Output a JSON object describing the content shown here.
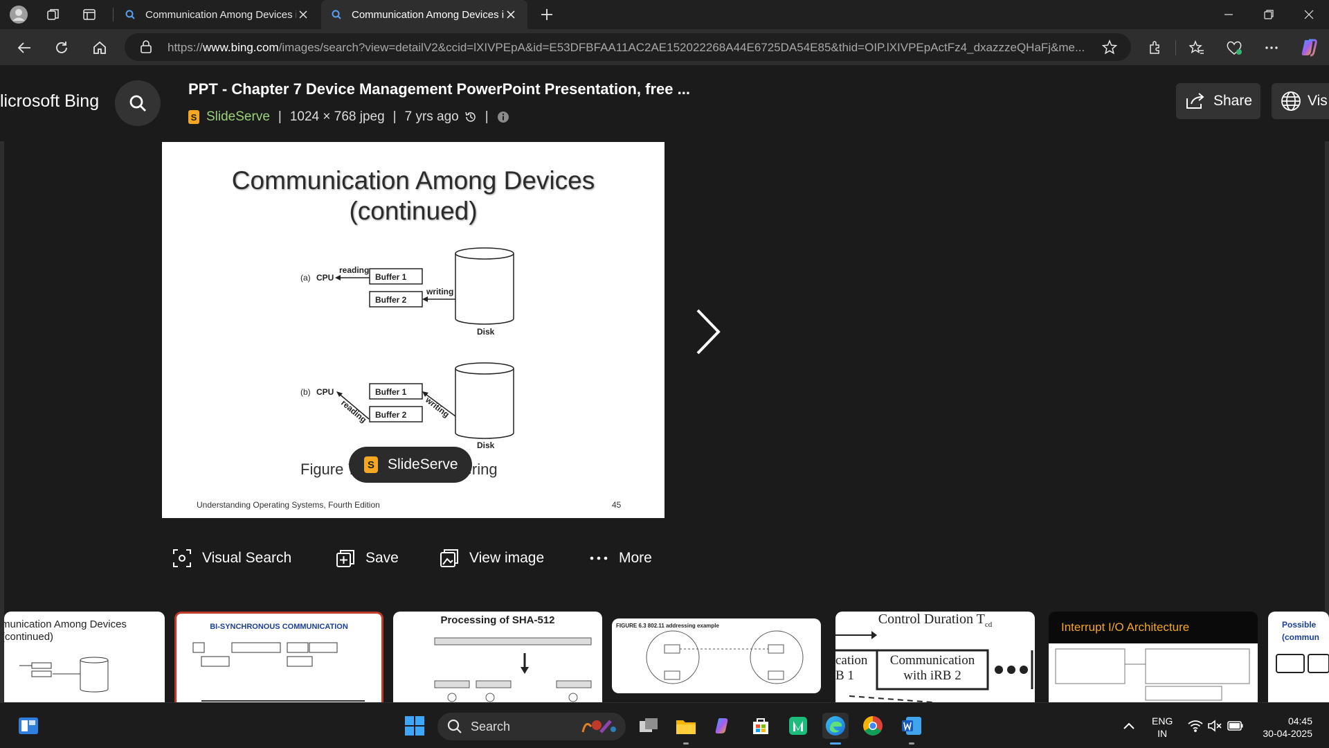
{
  "browser": {
    "tabs": [
      {
        "title": "Communication Among Devices i",
        "active": false
      },
      {
        "title": "Communication Among Devices i",
        "active": true
      }
    ],
    "url_prefix": "https://",
    "url_host": "www.bing.com",
    "url_rest": "/images/search?view=detailV2&ccid=lXIVPEpA&id=E53DFBFAA11AC2AE152022268A44E6725DA54E85&thid=OIP.lXIVPEpActFz4_dxazzzeQHaFj&me..."
  },
  "header": {
    "brand": "licrosoft Bing",
    "image_title": "PPT - Chapter 7 Device Management PowerPoint Presentation, free ...",
    "source_name": "SlideServe",
    "source_icon_letter": "S",
    "dimensions": "1024 × 768 jpeg",
    "age": "7 yrs ago",
    "share_label": "Share",
    "visit_label": "Vis"
  },
  "slide": {
    "title_line1": "Communication Among Devices",
    "title_line2": "(continued)",
    "caption": "Figure 7.13: Double buffering",
    "footer": "Understanding Operating Systems, Fourth Edition",
    "page_number": "45",
    "diagram": {
      "part_a": "(a)",
      "part_b": "(b)",
      "cpu": "CPU",
      "buffer1": "Buffer 1",
      "buffer2": "Buffer 2",
      "reading": "reading",
      "writing": "writing",
      "disk": "Disk"
    },
    "source_pill": "SlideServe"
  },
  "actions": {
    "visual_search": "Visual Search",
    "save": "Save",
    "view_image": "View image",
    "more": "More"
  },
  "related": [
    {
      "title": "munication Among Devices\n(continued)"
    },
    {
      "title": "BI-SYNCHRONOUS COMMUNICATION"
    },
    {
      "title": "Processing of SHA-512"
    },
    {
      "title": "FIGURE 6.3   802.11 addressing example"
    },
    {
      "title": "Control Duration T"
    },
    {
      "title": "Interrupt I/O Architecture"
    },
    {
      "title": "Possible (commun"
    }
  ],
  "related_extra": {
    "control_line1": "cation",
    "control_line2": "Communication",
    "control_line3": "with iRB 2",
    "control_line4": "B 1",
    "control_sub": "cd"
  },
  "taskbar": {
    "search_placeholder": "Search",
    "lang_line1": "ENG",
    "lang_line2": "IN",
    "time": "04:45",
    "date": "30-04-2025"
  },
  "colors": {
    "accent_green": "#9ad17a",
    "slideserve_orange": "#f5a623",
    "edge_blue": "#3a8ee6"
  }
}
